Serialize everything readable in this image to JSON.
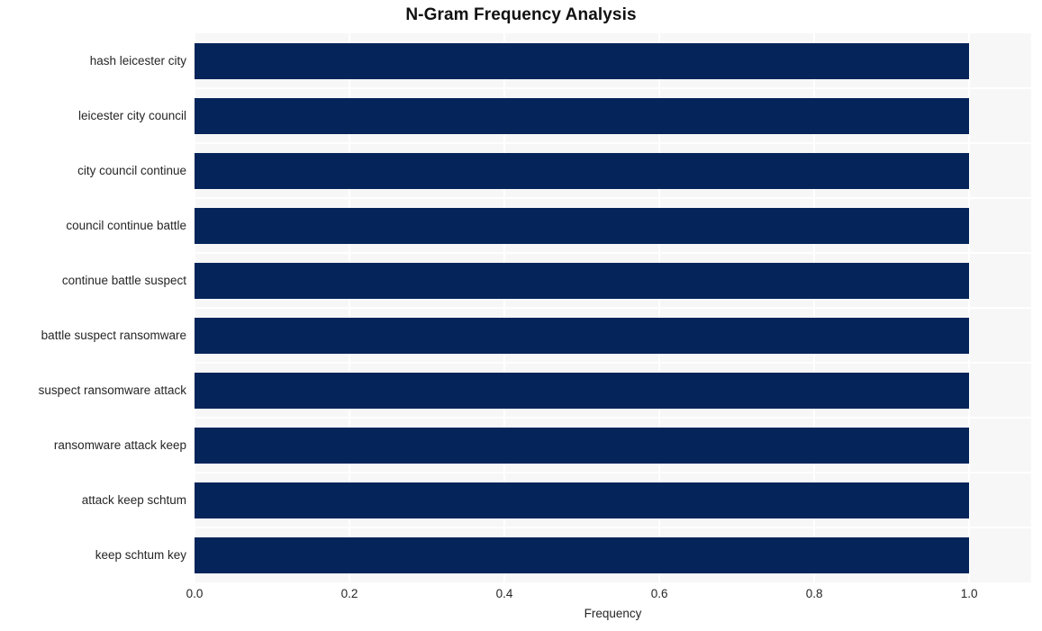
{
  "chart_data": {
    "type": "bar",
    "orientation": "horizontal",
    "title": "N-Gram Frequency Analysis",
    "xlabel": "Frequency",
    "ylabel": "",
    "categories": [
      "hash leicester city",
      "leicester city council",
      "city council continue",
      "council continue battle",
      "continue battle suspect",
      "battle suspect ransomware",
      "suspect ransomware attack",
      "ransomware attack keep",
      "attack keep schtum",
      "keep schtum key"
    ],
    "values": [
      1.0,
      1.0,
      1.0,
      1.0,
      1.0,
      1.0,
      1.0,
      1.0,
      1.0,
      1.0
    ],
    "xlim": [
      0.0,
      1.08
    ],
    "xticks": [
      0.0,
      0.2,
      0.4,
      0.6,
      0.8,
      1.0
    ],
    "xticklabels": [
      "0.0",
      "0.2",
      "0.4",
      "0.6",
      "0.8",
      "1.0"
    ],
    "grid": true,
    "legend": null,
    "bar_color": "#04245a",
    "plot_background": "#f7f7f7",
    "figure_background": "#ffffff",
    "gridline_color": "#ffffff",
    "text_color": "#262626"
  }
}
